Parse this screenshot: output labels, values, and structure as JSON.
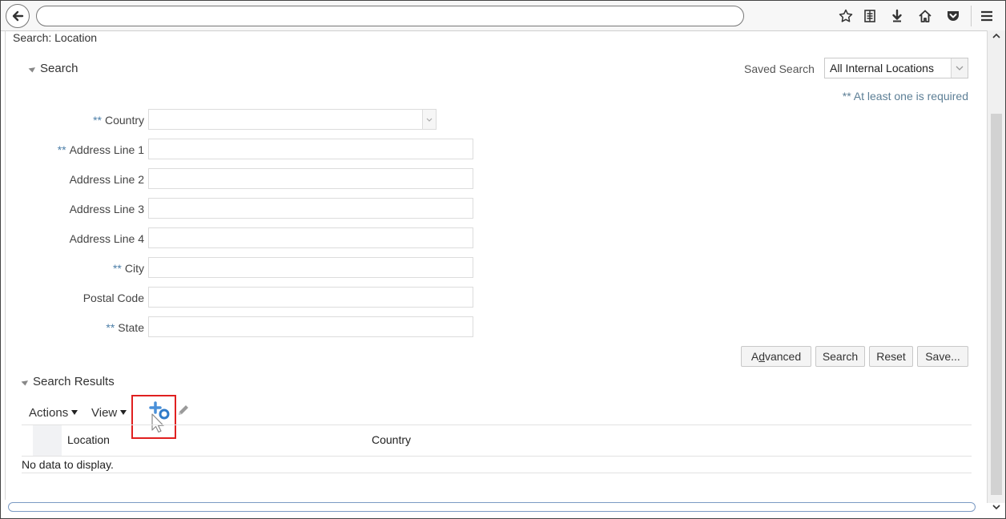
{
  "browser": {
    "icons": [
      "back-arrow-icon",
      "star-icon",
      "reader-icon",
      "download-icon",
      "home-icon",
      "pocket-icon",
      "menu-icon"
    ]
  },
  "page": {
    "title": "Search: Location"
  },
  "search": {
    "header": "Search",
    "saved_search_label": "Saved Search",
    "saved_search_value": "All Internal Locations",
    "required_note": "** At least one is required",
    "fields": [
      {
        "label": "Country",
        "required": "**",
        "type": "select",
        "value": ""
      },
      {
        "label": "Address Line 1",
        "required": "**",
        "type": "text",
        "value": ""
      },
      {
        "label": "Address Line 2",
        "required": "",
        "type": "text",
        "value": ""
      },
      {
        "label": "Address Line 3",
        "required": "",
        "type": "text",
        "value": ""
      },
      {
        "label": "Address Line 4",
        "required": "",
        "type": "text",
        "value": ""
      },
      {
        "label": "City",
        "required": "**",
        "type": "text",
        "value": ""
      },
      {
        "label": "Postal Code",
        "required": "",
        "type": "text",
        "value": ""
      },
      {
        "label": "State",
        "required": "**",
        "type": "text",
        "value": ""
      }
    ],
    "buttons": {
      "advanced": "Advanced",
      "search": "Search",
      "reset": "Reset",
      "save": "Save..."
    }
  },
  "results": {
    "header": "Search Results",
    "actions_label": "Actions",
    "view_label": "View",
    "columns": [
      "Location",
      "Country"
    ],
    "empty_text": "No data to display."
  },
  "colors": {
    "required_marker": "#4d7fa8",
    "highlight": "#e02020",
    "create_icon": "#4a90d9"
  }
}
